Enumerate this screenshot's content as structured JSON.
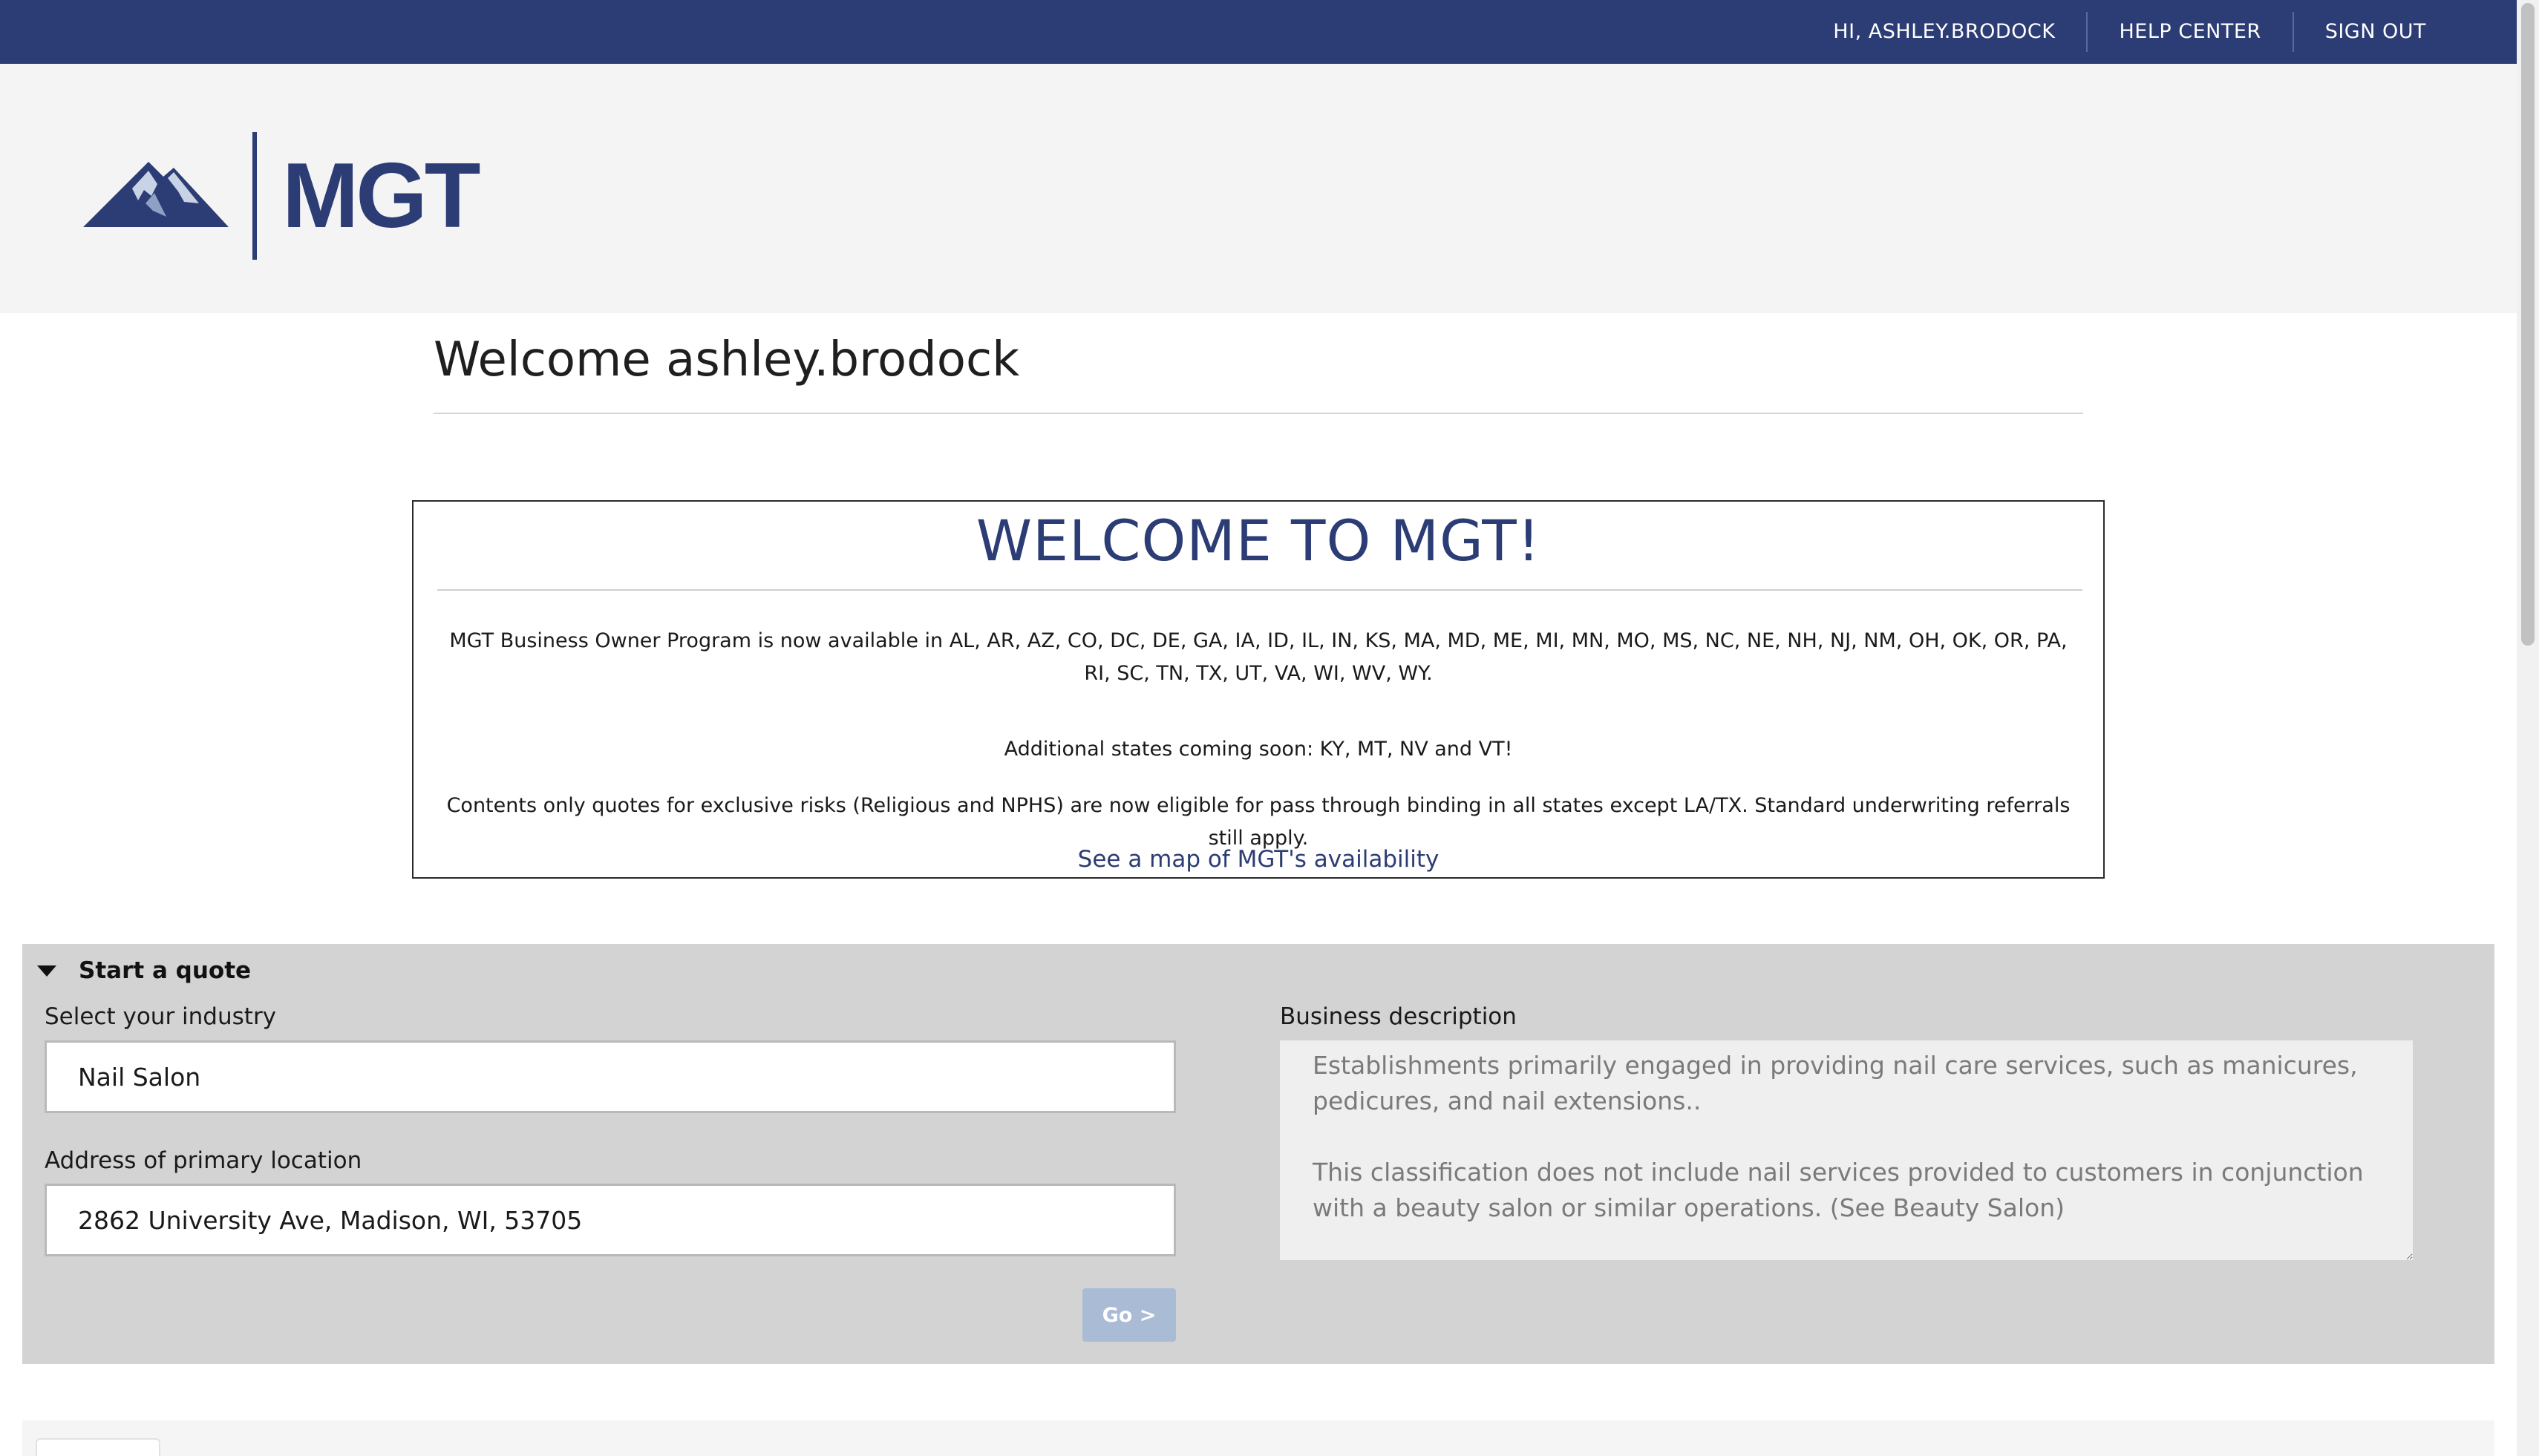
{
  "topnav": {
    "greeting": "HI, ASHLEY.BRODOCK",
    "help": "HELP CENTER",
    "signout": "SIGN OUT"
  },
  "brand": {
    "name": "MGT",
    "logo_icon": "mountain-logo-icon",
    "color": "#2c3c74"
  },
  "welcome": {
    "title": "Welcome ashley.brodock"
  },
  "announcement": {
    "heading": "WELCOME TO MGT!",
    "availability": "MGT Business Owner Program is now available in AL, AR, AZ, CO, DC, DE, GA, IA, ID, IL, IN, KS, MA, MD, ME, MI, MN, MO, MS, NC, NE, NH, NJ, NM, OH, OK, OR, PA, RI, SC, TN, TX, UT, VA, WI, WV, WY.",
    "coming_soon": "Additional states coming soon: KY, MT, NV and VT!",
    "contents_only": "Contents only quotes for exclusive risks (Religious and NPHS) are now eligible for pass through binding in all states except LA/TX. Standard underwriting referrals still apply.",
    "map_link": "See a map of MGT's availability"
  },
  "quote": {
    "toggle_label": "Start a quote",
    "industry_label": "Select your industry",
    "industry_value": "Nail Salon",
    "address_label": "Address of primary location",
    "address_value": "2862 University Ave, Madison, WI, 53705",
    "go_label": "Go >",
    "description_label": "Business description",
    "description_value": "Establishments primarily engaged in providing nail care services, such as manicures, pedicures, and nail extensions..\n\nThis classification does not include nail services provided to customers in conjunction with a beauty salon or similar operations. (See Beauty Salon)"
  }
}
